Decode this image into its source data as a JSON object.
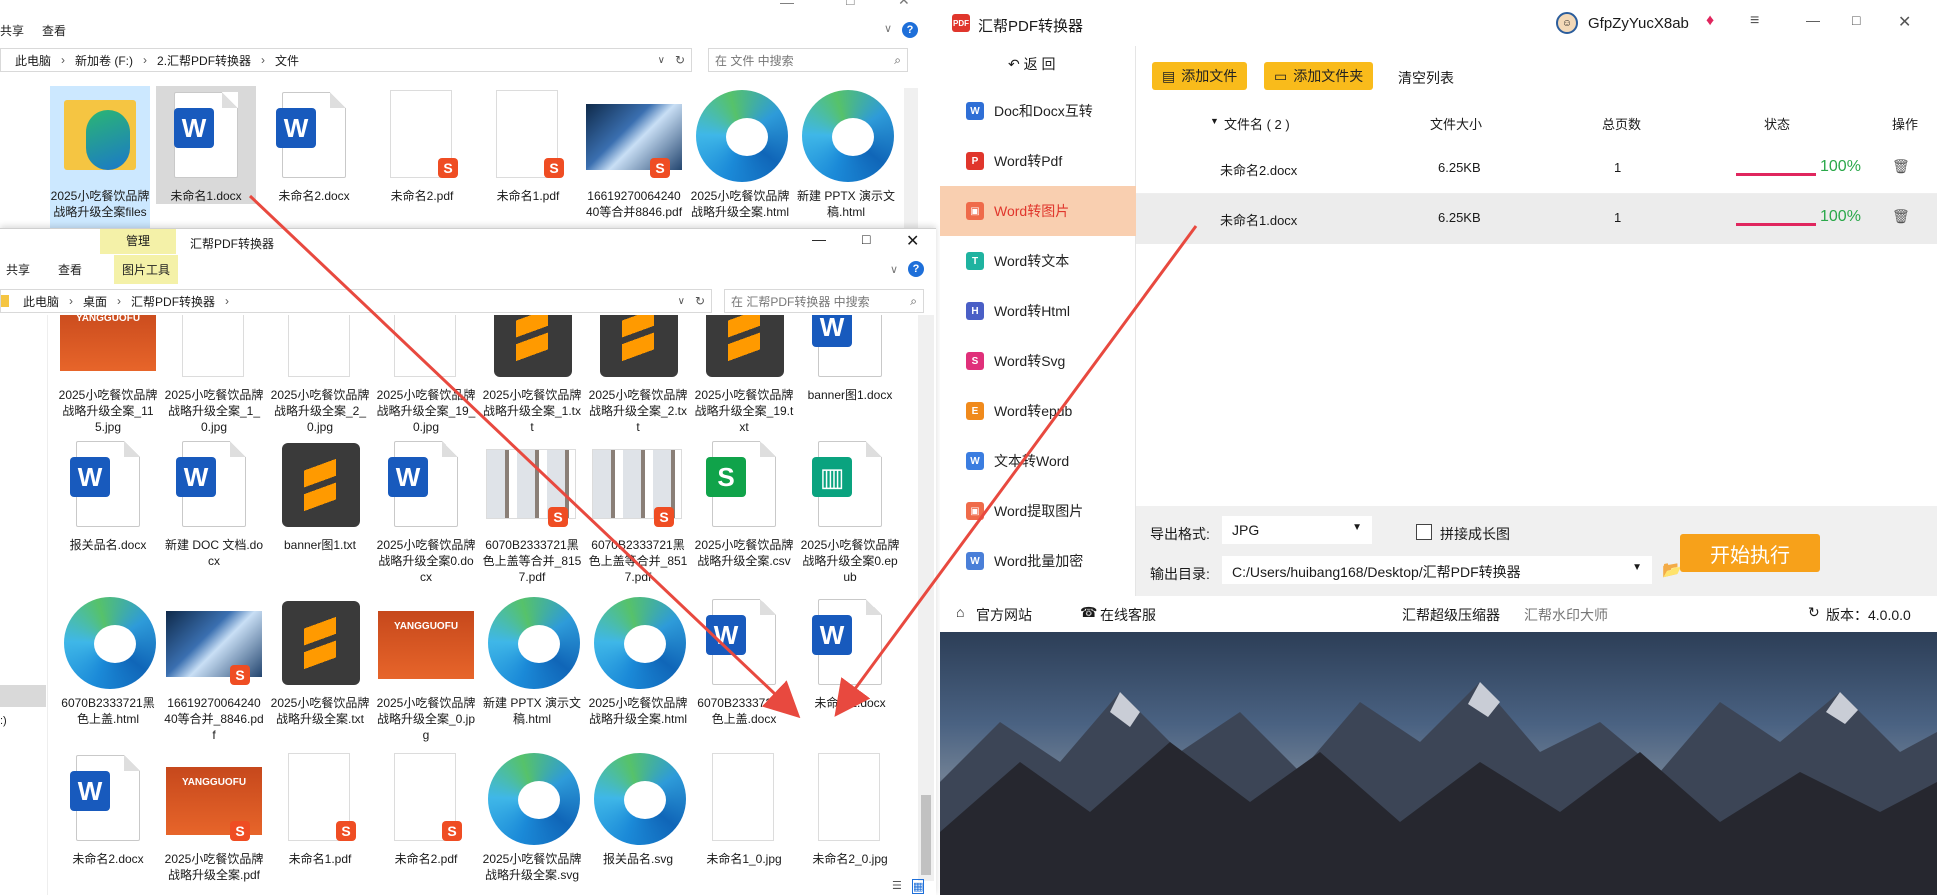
{
  "explorer_back": {
    "ribbon": {
      "share": "共享",
      "view": "查看"
    },
    "address": {
      "pc": "此电脑",
      "drive": "新加卷 (F:)",
      "folder1": "2.汇帮PDF转换器",
      "folder2": "文件"
    },
    "search_placeholder": "在 文件 中搜索",
    "files": [
      {
        "name": "2025小吃餐饮品牌战略升级全案files",
        "type": "folder"
      },
      {
        "name": "未命名1.docx",
        "type": "word"
      },
      {
        "name": "未命名2.docx",
        "type": "word"
      },
      {
        "name": "未命名2.pdf",
        "type": "pdf"
      },
      {
        "name": "未命名1.pdf",
        "type": "pdf"
      },
      {
        "name": "1661927006424040等合并8846.pdf",
        "type": "photo"
      },
      {
        "name": "2025小吃餐饮品牌战略升级全案.html",
        "type": "edge"
      },
      {
        "name": "新建 PPTX 演示文稿.html",
        "type": "edge"
      }
    ]
  },
  "explorer_front": {
    "title": "汇帮PDF转换器",
    "manage_tab": "管理",
    "picture_tools": "图片工具",
    "ribbon": {
      "share": "共享",
      "view": "查看"
    },
    "address": {
      "pc": "此电脑",
      "desktop": "桌面",
      "folder": "汇帮PDF转换器"
    },
    "search_placeholder": "在 汇帮PDF转换器 中搜索",
    "rows": [
      [
        {
          "name": "2025小吃餐饮品牌战略升级全案_115.jpg",
          "type": "ppt"
        },
        {
          "name": "2025小吃餐饮品牌战略升级全案_1_0.jpg",
          "type": "blank"
        },
        {
          "name": "2025小吃餐饮品牌战略升级全案_2_0.jpg",
          "type": "blank"
        },
        {
          "name": "2025小吃餐饮品牌战略升级全案_19_0.jpg",
          "type": "blank"
        },
        {
          "name": "2025小吃餐饮品牌战略升级全案_1.txt",
          "type": "sub"
        },
        {
          "name": "2025小吃餐饮品牌战略升级全案_2.txt",
          "type": "sub"
        },
        {
          "name": "2025小吃餐饮品牌战略升级全案_19.txt",
          "type": "sub"
        },
        {
          "name": "banner图1.docx",
          "type": "word"
        }
      ],
      [
        {
          "name": "报关品名.docx",
          "type": "word"
        },
        {
          "name": "新建 DOC 文档.docx",
          "type": "word"
        },
        {
          "name": "banner图1.txt",
          "type": "sub"
        },
        {
          "name": "2025小吃餐饮品牌战略升级全案0.docx",
          "type": "word"
        },
        {
          "name": "6070B2333721黑色上盖等合并_8157.pdf",
          "type": "scan"
        },
        {
          "name": "6070B2333721黑色上盖等合并_8517.pdf",
          "type": "scan"
        },
        {
          "name": "2025小吃餐饮品牌战略升级全案.csv",
          "type": "csv"
        },
        {
          "name": "2025小吃餐饮品牌战略升级全案0.epub",
          "type": "epub"
        }
      ],
      [
        {
          "name": "6070B2333721黑色上盖.html",
          "type": "edge"
        },
        {
          "name": "1661927006424040等合并_8846.pdf",
          "type": "photo"
        },
        {
          "name": "2025小吃餐饮品牌战略升级全案.txt",
          "type": "sub"
        },
        {
          "name": "2025小吃餐饮品牌战略升级全案_0.jpg",
          "type": "ppt"
        },
        {
          "name": "新建 PPTX 演示文稿.html",
          "type": "edge"
        },
        {
          "name": "2025小吃餐饮品牌战略升级全案.html",
          "type": "edge"
        },
        {
          "name": "6070B2333721黑色上盖.docx",
          "type": "word"
        },
        {
          "name": "未命名1.docx",
          "type": "word"
        }
      ],
      [
        {
          "name": "未命名2.docx",
          "type": "word"
        },
        {
          "name": "2025小吃餐饮品牌战略升级全案.pdf",
          "type": "pptpdf"
        },
        {
          "name": "未命名1.pdf",
          "type": "pdfblank"
        },
        {
          "name": "未命名2.pdf",
          "type": "pdfblank"
        },
        {
          "name": "2025小吃餐饮品牌战略升级全案.svg",
          "type": "edge"
        },
        {
          "name": "报关品名.svg",
          "type": "edge"
        },
        {
          "name": "未命名1_0.jpg",
          "type": "blank"
        },
        {
          "name": "未命名2_0.jpg",
          "type": "blank"
        }
      ]
    ],
    "ppt_brand": "YANGGUOFU"
  },
  "converter": {
    "app_title": "汇帮PDF转换器",
    "username": "GfpZyYucX8ab",
    "back_label": "返 回",
    "sidebar": [
      {
        "label": "Doc和Docx互转",
        "color": "#2f6fd6",
        "glyph": "W"
      },
      {
        "label": "Word转Pdf",
        "color": "#e0362c",
        "glyph": "P"
      },
      {
        "label": "Word转图片",
        "color": "#ef6b4a",
        "glyph": "▣"
      },
      {
        "label": "Word转文本",
        "color": "#1fb3a0",
        "glyph": "T"
      },
      {
        "label": "Word转Html",
        "color": "#4a5fc6",
        "glyph": "H"
      },
      {
        "label": "Word转Svg",
        "color": "#e0307a",
        "glyph": "S"
      },
      {
        "label": "Word转epub",
        "color": "#f08a1c",
        "glyph": "E"
      },
      {
        "label": "文本转Word",
        "color": "#3b7de0",
        "glyph": "W"
      },
      {
        "label": "Word提取图片",
        "color": "#ef6b4a",
        "glyph": "▣"
      },
      {
        "label": "Word批量加密",
        "color": "#4a7fd8",
        "glyph": "W"
      }
    ],
    "toolbar": {
      "add_file": "添加文件",
      "add_folder": "添加文件夹",
      "clear": "清空列表"
    },
    "table": {
      "headers": {
        "name": "文件名 ( 2 )",
        "size": "文件大小",
        "pages": "总页数",
        "status": "状态",
        "ops": "操作"
      },
      "rows": [
        {
          "name": "未命名2.docx",
          "size": "6.25KB",
          "pages": "1",
          "progress": "100%"
        },
        {
          "name": "未命名1.docx",
          "size": "6.25KB",
          "pages": "1",
          "progress": "100%"
        }
      ]
    },
    "export_format_label": "导出格式:",
    "export_format_value": "JPG",
    "merge_label": "拼接成长图",
    "output_dir_label": "输出目录:",
    "output_dir_value": "C:/Users/huibang168/Desktop/汇帮PDF转换器",
    "start_button": "开始执行",
    "footer": {
      "website": "官方网站",
      "support": "在线客服",
      "compressor": "汇帮超级压缩器",
      "watermark": "汇帮水印大师",
      "version": "版本：4.0.0.0"
    },
    "colors": {
      "accent": "#f9bb1b",
      "active_item_bg": "#f9cfb0",
      "progress": "#e0265e",
      "start_btn": "#f7a11a"
    }
  }
}
